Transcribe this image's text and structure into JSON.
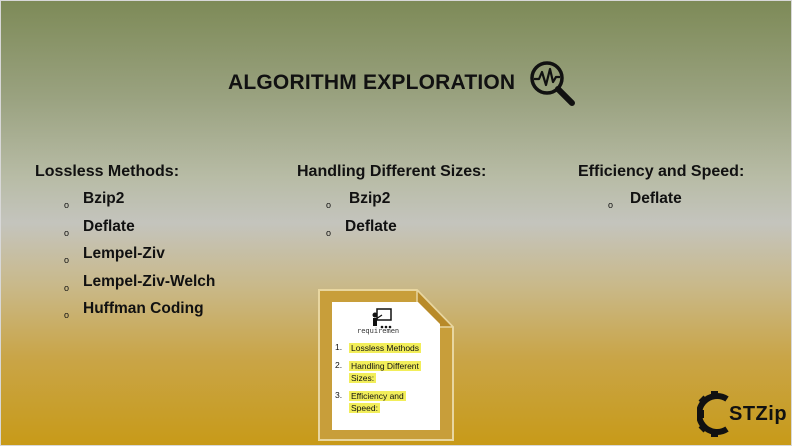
{
  "slide": {
    "title": "ALGORITHM EXPLORATION",
    "title_icon": "magnifier-with-waveform-icon",
    "colors": {
      "text": "#111111",
      "gradient_top": "#7d8a57",
      "gradient_bottom": "#c89a18",
      "highlight": "#f2ee5a"
    }
  },
  "columns": [
    {
      "heading": "Lossless Methods:",
      "items": [
        "Bzip2",
        "Deflate",
        "Lempel-Ziv",
        "Lempel-Ziv-Welch",
        "Huffman Coding"
      ]
    },
    {
      "heading": "Handling Different Sizes:",
      "items": [
        "Bzip2",
        "Deflate"
      ]
    },
    {
      "heading": "Efficiency and Speed:",
      "items": [
        "Deflate"
      ]
    }
  ],
  "bullet_glyph": "o",
  "document_graphic": {
    "caption": "requiremen",
    "list": [
      {
        "num": "1.",
        "line1": "Lossless Methods",
        "line2": ""
      },
      {
        "num": "2.",
        "line1": "Handling Different",
        "line2": "Sizes:"
      },
      {
        "num": "3.",
        "line1": "Efficiency and",
        "line2": "Speed:"
      }
    ]
  },
  "logo": {
    "text": "STZip",
    "icon": "gear-icon"
  }
}
